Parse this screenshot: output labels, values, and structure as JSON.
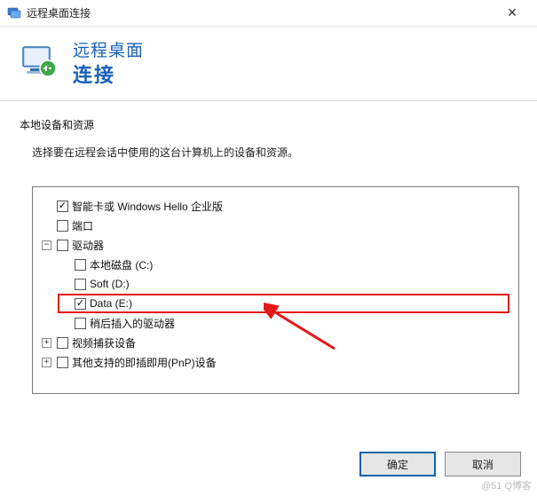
{
  "titlebar": {
    "title": "远程桌面连接"
  },
  "header": {
    "line1": "远程桌面",
    "line2": "连接"
  },
  "section": {
    "title": "本地设备和资源",
    "desc": "选择要在远程会话中使用的这台计算机上的设备和资源。"
  },
  "tree": {
    "smartcard": {
      "label": "智能卡或 Windows Hello 企业版",
      "checked": true
    },
    "ports": {
      "label": "端口",
      "checked": false
    },
    "drives": {
      "label": "驱动器",
      "checked": false,
      "expanded": true,
      "children": {
        "localC": {
          "label": "本地磁盘 (C:)",
          "checked": false
        },
        "softD": {
          "label": "Soft (D:)",
          "checked": false
        },
        "dataE": {
          "label": "Data (E:)",
          "checked": true
        },
        "later": {
          "label": "稍后插入的驱动器",
          "checked": false
        }
      }
    },
    "video": {
      "label": "视频捕获设备",
      "checked": false,
      "expanded": false
    },
    "pnp": {
      "label": "其他支持的即插即用(PnP)设备",
      "checked": false,
      "expanded": false
    }
  },
  "buttons": {
    "ok": "确定",
    "cancel": "取消"
  },
  "watermark": "@51  Q博客",
  "expander": {
    "plus": "+",
    "minus": "−"
  }
}
